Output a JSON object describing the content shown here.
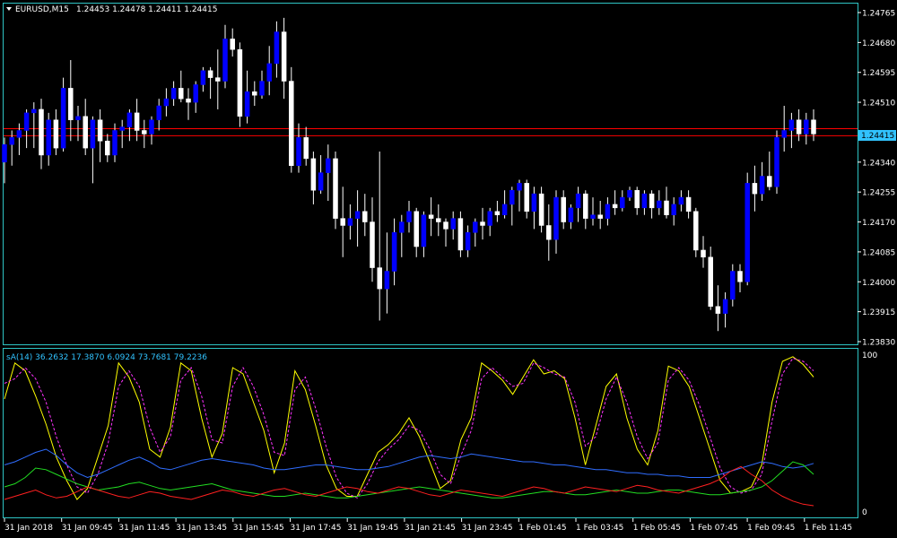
{
  "colors": {
    "background": "#000000",
    "frame": "#2ec4c4",
    "bull": "#0000ff",
    "bear": "#ffffff",
    "wick": "#ffffff",
    "ask_line": "#ff0000",
    "bid_line": "#d0d0d0",
    "price_tag_bg": "#31c3ff",
    "osc_yellow": "#ffff00",
    "osc_magenta": "#ff33ff",
    "osc_blue": "#2f6dff",
    "osc_green": "#22dd22",
    "osc_red": "#ff2020"
  },
  "header": {
    "arrow_icon": "triangle-down-icon",
    "symbol": "EURUSD,M15",
    "ohlc": "1.24453 1.24478 1.24411 1.24415"
  },
  "price_tag": "1.24415",
  "indicator_label": "sA(14) 36.2632 17.3870 6.0924 73.7681 79.2236",
  "chart_data": [
    {
      "type": "candlestick",
      "title": "EURUSD,M15",
      "ylim": [
        1.2383,
        1.2476
      ],
      "y_ticks": [
        "1.24765",
        "1.24680",
        "1.24595",
        "1.24510",
        "1.24340",
        "1.24255",
        "1.24170",
        "1.24085",
        "1.24000",
        "1.23915",
        "1.23830"
      ],
      "x_ticks": [
        "31 Jan 2018",
        "31 Jan 09:45",
        "31 Jan 11:45",
        "31 Jan 13:45",
        "31 Jan 15:45",
        "31 Jan 17:45",
        "31 Jan 19:45",
        "31 Jan 21:45",
        "31 Jan 23:45",
        "1 Feb 01:45",
        "1 Feb 03:45",
        "1 Feb 05:45",
        "1 Feb 07:45",
        "1 Feb 09:45",
        "1 Feb 11:45"
      ],
      "current_price": 1.24415,
      "ask_price": 1.24435,
      "candles_ohlc": [
        [
          1.2434,
          1.2441,
          1.2428,
          1.2439
        ],
        [
          1.2439,
          1.2443,
          1.2433,
          1.2441
        ],
        [
          1.2441,
          1.2445,
          1.2436,
          1.2443
        ],
        [
          1.2443,
          1.2449,
          1.2438,
          1.2448
        ],
        [
          1.2448,
          1.2451,
          1.2438,
          1.2449
        ],
        [
          1.2449,
          1.2452,
          1.2432,
          1.2436
        ],
        [
          1.2436,
          1.2448,
          1.2433,
          1.2446
        ],
        [
          1.2446,
          1.2449,
          1.2436,
          1.2438
        ],
        [
          1.2438,
          1.2458,
          1.2437,
          1.2455
        ],
        [
          1.2455,
          1.2463,
          1.244,
          1.2446
        ],
        [
          1.2446,
          1.245,
          1.244,
          1.2447
        ],
        [
          1.2447,
          1.2452,
          1.2436,
          1.2438
        ],
        [
          1.2438,
          1.2447,
          1.2428,
          1.2446
        ],
        [
          1.2446,
          1.2449,
          1.2434,
          1.244
        ],
        [
          1.244,
          1.2442,
          1.2434,
          1.2436
        ],
        [
          1.2436,
          1.2445,
          1.2434,
          1.2443
        ],
        [
          1.2443,
          1.2446,
          1.2438,
          1.2444
        ],
        [
          1.2444,
          1.2449,
          1.244,
          1.2448
        ],
        [
          1.2448,
          1.2452,
          1.244,
          1.2443
        ],
        [
          1.2443,
          1.2446,
          1.2438,
          1.2442
        ],
        [
          1.2442,
          1.2447,
          1.2439,
          1.2446
        ],
        [
          1.2446,
          1.2452,
          1.2443,
          1.245
        ],
        [
          1.245,
          1.2455,
          1.2447,
          1.2452
        ],
        [
          1.2452,
          1.2457,
          1.245,
          1.2455
        ],
        [
          1.2455,
          1.246,
          1.2451,
          1.2452
        ],
        [
          1.2452,
          1.2455,
          1.2446,
          1.2451
        ],
        [
          1.2451,
          1.2457,
          1.2448,
          1.2456
        ],
        [
          1.2456,
          1.2461,
          1.2454,
          1.246
        ],
        [
          1.246,
          1.2461,
          1.2452,
          1.2458
        ],
        [
          1.2458,
          1.2466,
          1.2449,
          1.2457
        ],
        [
          1.2457,
          1.2473,
          1.2455,
          1.2469
        ],
        [
          1.2469,
          1.2472,
          1.2464,
          1.2466
        ],
        [
          1.2466,
          1.2468,
          1.2444,
          1.2447
        ],
        [
          1.2447,
          1.246,
          1.2445,
          1.2454
        ],
        [
          1.2454,
          1.2457,
          1.245,
          1.2453
        ],
        [
          1.2453,
          1.246,
          1.2452,
          1.2457
        ],
        [
          1.2457,
          1.2467,
          1.2453,
          1.2462
        ],
        [
          1.2462,
          1.2474,
          1.2458,
          1.2471
        ],
        [
          1.2471,
          1.2475,
          1.2452,
          1.2457
        ],
        [
          1.2457,
          1.2461,
          1.2431,
          1.2433
        ],
        [
          1.2433,
          1.2445,
          1.2431,
          1.2441
        ],
        [
          1.2441,
          1.2444,
          1.2433,
          1.2435
        ],
        [
          1.2435,
          1.2437,
          1.2422,
          1.2426
        ],
        [
          1.2426,
          1.2436,
          1.2425,
          1.2431
        ],
        [
          1.2431,
          1.2439,
          1.2423,
          1.2435
        ],
        [
          1.2435,
          1.2437,
          1.2415,
          1.2418
        ],
        [
          1.2418,
          1.2427,
          1.2407,
          1.2416
        ],
        [
          1.2416,
          1.2422,
          1.2412,
          1.2418
        ],
        [
          1.2418,
          1.2426,
          1.241,
          1.242
        ],
        [
          1.242,
          1.2425,
          1.2413,
          1.2417
        ],
        [
          1.2417,
          1.2424,
          1.24,
          1.2404
        ],
        [
          1.2404,
          1.2437,
          1.2389,
          1.2398
        ],
        [
          1.2398,
          1.2414,
          1.2391,
          1.2403
        ],
        [
          1.2403,
          1.2418,
          1.2399,
          1.2414
        ],
        [
          1.2414,
          1.2419,
          1.2407,
          1.2417
        ],
        [
          1.2417,
          1.2423,
          1.2414,
          1.242
        ],
        [
          1.242,
          1.2421,
          1.2407,
          1.241
        ],
        [
          1.241,
          1.242,
          1.2407,
          1.2419
        ],
        [
          1.2419,
          1.2424,
          1.2413,
          1.2418
        ],
        [
          1.2418,
          1.2422,
          1.2413,
          1.2417
        ],
        [
          1.2417,
          1.2418,
          1.241,
          1.2415
        ],
        [
          1.2415,
          1.242,
          1.2412,
          1.2418
        ],
        [
          1.2418,
          1.242,
          1.2407,
          1.2409
        ],
        [
          1.2409,
          1.2416,
          1.2407,
          1.2414
        ],
        [
          1.2414,
          1.2418,
          1.241,
          1.2417
        ],
        [
          1.2417,
          1.2421,
          1.2412,
          1.2416
        ],
        [
          1.2416,
          1.2421,
          1.2413,
          1.242
        ],
        [
          1.242,
          1.2423,
          1.2417,
          1.2419
        ],
        [
          1.2419,
          1.2426,
          1.2418,
          1.2422
        ],
        [
          1.2422,
          1.2427,
          1.2416,
          1.2426
        ],
        [
          1.2426,
          1.2429,
          1.242,
          1.2428
        ],
        [
          1.2428,
          1.2429,
          1.2418,
          1.242
        ],
        [
          1.242,
          1.2427,
          1.2415,
          1.2425
        ],
        [
          1.2425,
          1.2427,
          1.2414,
          1.2416
        ],
        [
          1.2416,
          1.2422,
          1.2406,
          1.2412
        ],
        [
          1.2412,
          1.2426,
          1.2408,
          1.2424
        ],
        [
          1.2424,
          1.2426,
          1.2415,
          1.2417
        ],
        [
          1.2417,
          1.2422,
          1.2415,
          1.2421
        ],
        [
          1.2421,
          1.2427,
          1.2417,
          1.2425
        ],
        [
          1.2425,
          1.2426,
          1.2415,
          1.2418
        ],
        [
          1.2418,
          1.2424,
          1.2416,
          1.2419
        ],
        [
          1.2419,
          1.2423,
          1.2415,
          1.2418
        ],
        [
          1.2418,
          1.2424,
          1.2416,
          1.2422
        ],
        [
          1.2422,
          1.2426,
          1.2419,
          1.2421
        ],
        [
          1.2421,
          1.2426,
          1.242,
          1.2424
        ],
        [
          1.2424,
          1.2427,
          1.2423,
          1.2426
        ],
        [
          1.2426,
          1.2427,
          1.2419,
          1.2421
        ],
        [
          1.2421,
          1.2426,
          1.2419,
          1.2425
        ],
        [
          1.2425,
          1.2426,
          1.2418,
          1.2421
        ],
        [
          1.2421,
          1.2426,
          1.2419,
          1.2423
        ],
        [
          1.2423,
          1.2427,
          1.2418,
          1.2419
        ],
        [
          1.2419,
          1.2424,
          1.2416,
          1.2422
        ],
        [
          1.2422,
          1.2426,
          1.242,
          1.2424
        ],
        [
          1.2424,
          1.2426,
          1.2418,
          1.242
        ],
        [
          1.242,
          1.2421,
          1.2407,
          1.2409
        ],
        [
          1.2409,
          1.2413,
          1.2404,
          1.2407
        ],
        [
          1.2407,
          1.241,
          1.2392,
          1.2393
        ],
        [
          1.2393,
          1.2399,
          1.2386,
          1.2391
        ],
        [
          1.2391,
          1.2397,
          1.2387,
          1.2395
        ],
        [
          1.2395,
          1.2405,
          1.2393,
          1.2403
        ],
        [
          1.2403,
          1.2405,
          1.2397,
          1.24
        ],
        [
          1.24,
          1.2431,
          1.2399,
          1.2428
        ],
        [
          1.2428,
          1.2433,
          1.242,
          1.2425
        ],
        [
          1.2425,
          1.2434,
          1.2423,
          1.243
        ],
        [
          1.243,
          1.2437,
          1.2426,
          1.2427
        ],
        [
          1.2427,
          1.2443,
          1.2425,
          1.2441
        ],
        [
          1.2441,
          1.245,
          1.2437,
          1.2443
        ],
        [
          1.2443,
          1.2448,
          1.2438,
          1.2446
        ],
        [
          1.2446,
          1.2449,
          1.244,
          1.2442
        ],
        [
          1.2442,
          1.2448,
          1.2439,
          1.2446
        ],
        [
          1.2446,
          1.2449,
          1.244,
          1.2442
        ]
      ]
    },
    {
      "type": "line",
      "title": "sA(14) 36.2632 17.3870 6.0924 73.7681 79.2236",
      "ylim": [
        0,
        100
      ],
      "y_ticks": [
        "100",
        "0"
      ],
      "series": [
        {
          "color": "#ffff00",
          "values": [
            72,
            95,
            90,
            74,
            56,
            35,
            20,
            8,
            15,
            35,
            55,
            95,
            86,
            70,
            40,
            35,
            54,
            95,
            90,
            60,
            35,
            50,
            92,
            88,
            70,
            52,
            25,
            44,
            90,
            78,
            55,
            30,
            15,
            10,
            10,
            24,
            38,
            43,
            50,
            60,
            48,
            32,
            15,
            20,
            46,
            60,
            95,
            90,
            84,
            75,
            86,
            97,
            88,
            90,
            85,
            60,
            30,
            55,
            80,
            88,
            60,
            40,
            30,
            52,
            93,
            90,
            80,
            60,
            40,
            20,
            12,
            13,
            16,
            30,
            70,
            96,
            99,
            94,
            86
          ]
        },
        {
          "color": "#ff33ff",
          "values": [
            82,
            85,
            92,
            85,
            70,
            48,
            30,
            16,
            12,
            24,
            44,
            80,
            90,
            80,
            54,
            38,
            48,
            84,
            92,
            74,
            46,
            44,
            80,
            92,
            80,
            62,
            38,
            36,
            78,
            86,
            66,
            42,
            22,
            12,
            9,
            18,
            32,
            40,
            46,
            55,
            52,
            40,
            24,
            18,
            36,
            52,
            85,
            92,
            86,
            80,
            82,
            95,
            92,
            88,
            86,
            70,
            42,
            48,
            72,
            86,
            70,
            48,
            34,
            44,
            84,
            92,
            84,
            68,
            48,
            28,
            16,
            12,
            14,
            24,
            58,
            88,
            98,
            96,
            90
          ]
        },
        {
          "color": "#2f6dff",
          "values": [
            30,
            32,
            35,
            38,
            40,
            36,
            30,
            25,
            22,
            24,
            27,
            30,
            33,
            35,
            32,
            28,
            27,
            29,
            31,
            33,
            34,
            33,
            32,
            31,
            30,
            28,
            27,
            27,
            28,
            29,
            30,
            30,
            29,
            28,
            27,
            27,
            28,
            29,
            31,
            33,
            35,
            36,
            35,
            34,
            35,
            37,
            36,
            35,
            34,
            33,
            32,
            32,
            31,
            30,
            30,
            29,
            28,
            27,
            27,
            26,
            25,
            25,
            24,
            24,
            23,
            23,
            22,
            22,
            22,
            24,
            26,
            28,
            30,
            32,
            31,
            29,
            28,
            29,
            31
          ]
        },
        {
          "color": "#22dd22",
          "values": [
            16,
            18,
            22,
            28,
            27,
            24,
            21,
            18,
            16,
            14,
            15,
            16,
            18,
            19,
            17,
            15,
            14,
            15,
            16,
            17,
            18,
            16,
            14,
            13,
            12,
            11,
            10,
            10,
            11,
            12,
            11,
            10,
            9,
            9,
            10,
            11,
            12,
            13,
            14,
            15,
            16,
            15,
            14,
            13,
            12,
            11,
            10,
            9,
            9,
            10,
            11,
            12,
            13,
            13,
            12,
            11,
            11,
            12,
            13,
            14,
            13,
            12,
            12,
            13,
            14,
            14,
            13,
            12,
            11,
            11,
            12,
            13,
            14,
            16,
            20,
            26,
            32,
            30,
            24
          ]
        },
        {
          "color": "#ff2020",
          "values": [
            8,
            10,
            12,
            14,
            11,
            9,
            10,
            13,
            16,
            14,
            12,
            10,
            9,
            11,
            13,
            12,
            10,
            9,
            8,
            10,
            12,
            14,
            13,
            11,
            10,
            12,
            14,
            15,
            13,
            11,
            10,
            12,
            14,
            16,
            15,
            13,
            12,
            14,
            16,
            15,
            13,
            11,
            10,
            12,
            14,
            13,
            12,
            11,
            10,
            12,
            14,
            16,
            15,
            13,
            12,
            14,
            16,
            15,
            14,
            13,
            15,
            17,
            16,
            14,
            13,
            12,
            14,
            16,
            18,
            21,
            26,
            29,
            24,
            20,
            14,
            10,
            7,
            5,
            4
          ]
        }
      ]
    }
  ]
}
